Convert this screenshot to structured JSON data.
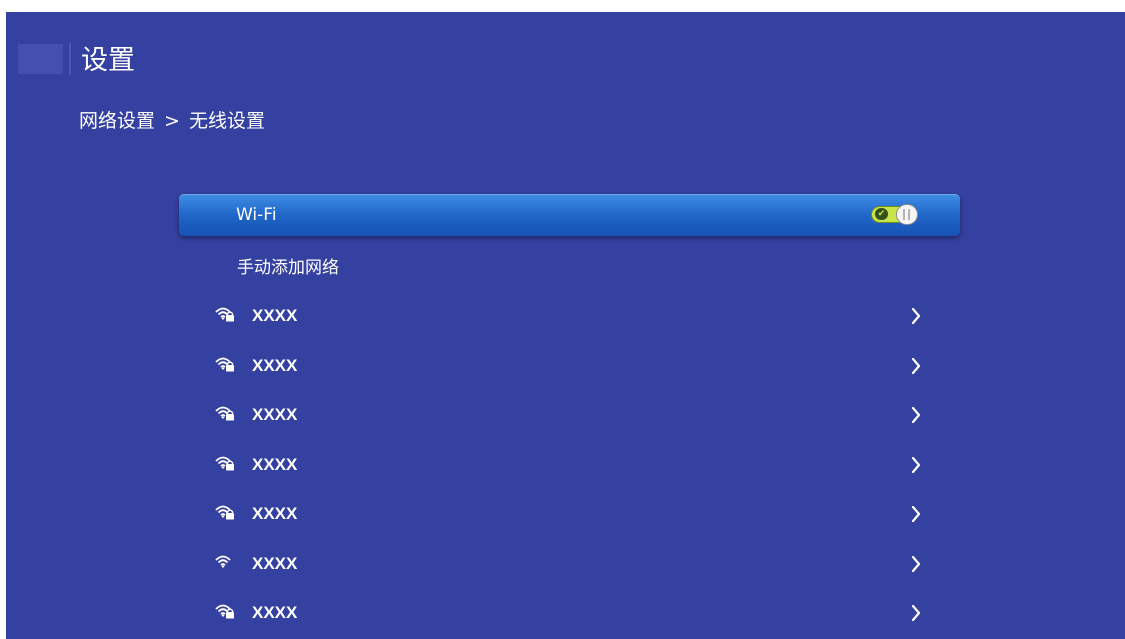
{
  "header": {
    "title": "设置"
  },
  "breadcrumb": {
    "parent": "网络设置",
    "separator": ">",
    "current": "无线设置"
  },
  "wifi_toggle": {
    "label": "Wi-Fi",
    "state": "on",
    "icons": [
      "check-icon",
      "toggle-knob-icon"
    ]
  },
  "manual_add": {
    "label": "手动添加网络"
  },
  "networks": [
    {
      "name": "XXXX",
      "icon": "wifi-lock-icon",
      "secured": true
    },
    {
      "name": "XXXX",
      "icon": "wifi-lock-icon",
      "secured": true
    },
    {
      "name": "XXXX",
      "icon": "wifi-lock-icon",
      "secured": true
    },
    {
      "name": "XXXX",
      "icon": "wifi-lock-icon",
      "secured": true
    },
    {
      "name": "XXXX",
      "icon": "wifi-lock-icon",
      "secured": true
    },
    {
      "name": "XXXX",
      "icon": "wifi-icon",
      "secured": false
    },
    {
      "name": "XXXX",
      "icon": "wifi-lock-icon",
      "secured": true
    }
  ],
  "colors": {
    "background": "#3541a0",
    "highlight": "#2066c9",
    "toggle_on": "#c7e44a",
    "text": "#ffffff"
  }
}
